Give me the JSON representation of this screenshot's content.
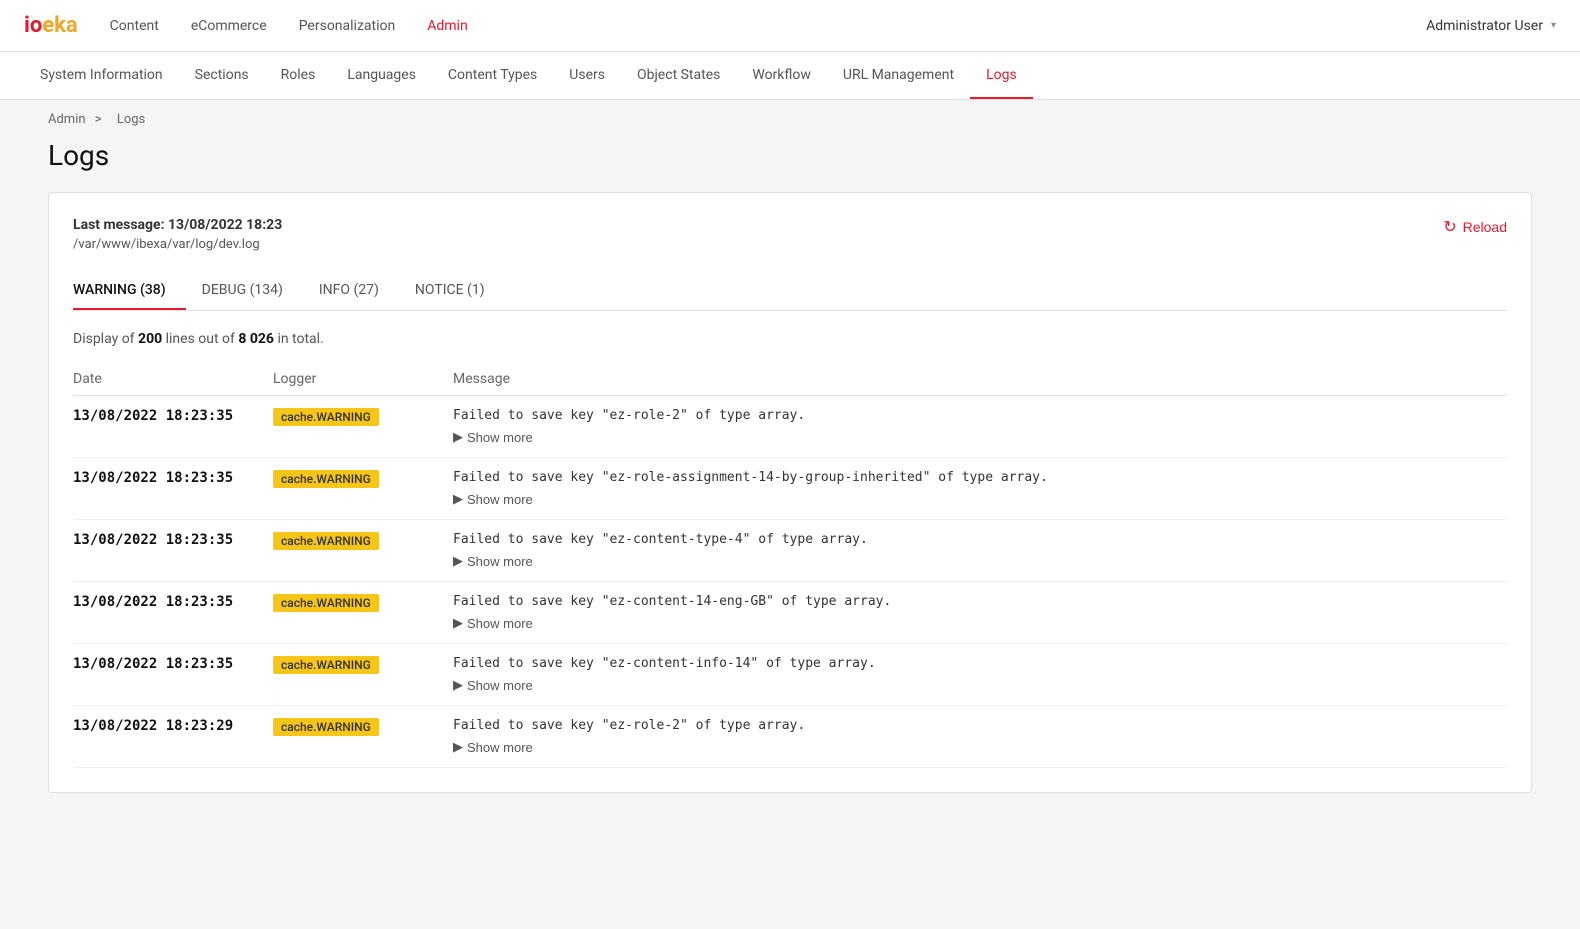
{
  "brand": {
    "logo_io": "io",
    "logo_eka": "eka"
  },
  "top_nav": {
    "links": [
      {
        "label": "Content",
        "active": false
      },
      {
        "label": "eCommerce",
        "active": false
      },
      {
        "label": "Personalization",
        "active": false
      },
      {
        "label": "Admin",
        "active": true
      }
    ],
    "user": "Administrator User"
  },
  "sub_nav": {
    "items": [
      {
        "label": "System Information",
        "active": false
      },
      {
        "label": "Sections",
        "active": false
      },
      {
        "label": "Roles",
        "active": false
      },
      {
        "label": "Languages",
        "active": false
      },
      {
        "label": "Content Types",
        "active": false
      },
      {
        "label": "Users",
        "active": false
      },
      {
        "label": "Object States",
        "active": false
      },
      {
        "label": "Workflow",
        "active": false
      },
      {
        "label": "URL Management",
        "active": false
      },
      {
        "label": "Logs",
        "active": true
      }
    ]
  },
  "breadcrumb": {
    "admin": "Admin",
    "separator": ">",
    "current": "Logs"
  },
  "page_title": "Logs",
  "log_info": {
    "last_message_label": "Last message: 13/08/2022 18:23",
    "log_path": "/var/www/ibexa/var/log/dev.log",
    "reload_label": "Reload"
  },
  "tabs": [
    {
      "label": "WARNING (38)",
      "active": true
    },
    {
      "label": "DEBUG (134)",
      "active": false
    },
    {
      "label": "INFO (27)",
      "active": false
    },
    {
      "label": "NOTICE (1)",
      "active": false
    }
  ],
  "display_info": {
    "text_prefix": "Display of ",
    "count": "200",
    "text_mid": " lines out of ",
    "total": "8 026",
    "text_suffix": " in total."
  },
  "table": {
    "headers": [
      "Date",
      "Logger",
      "Message"
    ],
    "rows": [
      {
        "date": "13/08/2022 18:23:35",
        "badge": "cache.WARNING",
        "message": "Failed to save key \"ez-role-2\" of type array.",
        "show_more": "Show more"
      },
      {
        "date": "13/08/2022 18:23:35",
        "badge": "cache.WARNING",
        "message": "Failed to save key \"ez-role-assignment-14-by-group-inherited\" of type array.",
        "show_more": "Show more"
      },
      {
        "date": "13/08/2022 18:23:35",
        "badge": "cache.WARNING",
        "message": "Failed to save key \"ez-content-type-4\" of type array.",
        "show_more": "Show more"
      },
      {
        "date": "13/08/2022 18:23:35",
        "badge": "cache.WARNING",
        "message": "Failed to save key \"ez-content-14-eng-GB\" of type array.",
        "show_more": "Show more"
      },
      {
        "date": "13/08/2022 18:23:35",
        "badge": "cache.WARNING",
        "message": "Failed to save key \"ez-content-info-14\" of type array.",
        "show_more": "Show more"
      },
      {
        "date": "13/08/2022 18:23:29",
        "badge": "cache.WARNING",
        "message": "Failed to save key \"ez-role-2\" of type array.",
        "show_more": "Show more"
      }
    ]
  }
}
